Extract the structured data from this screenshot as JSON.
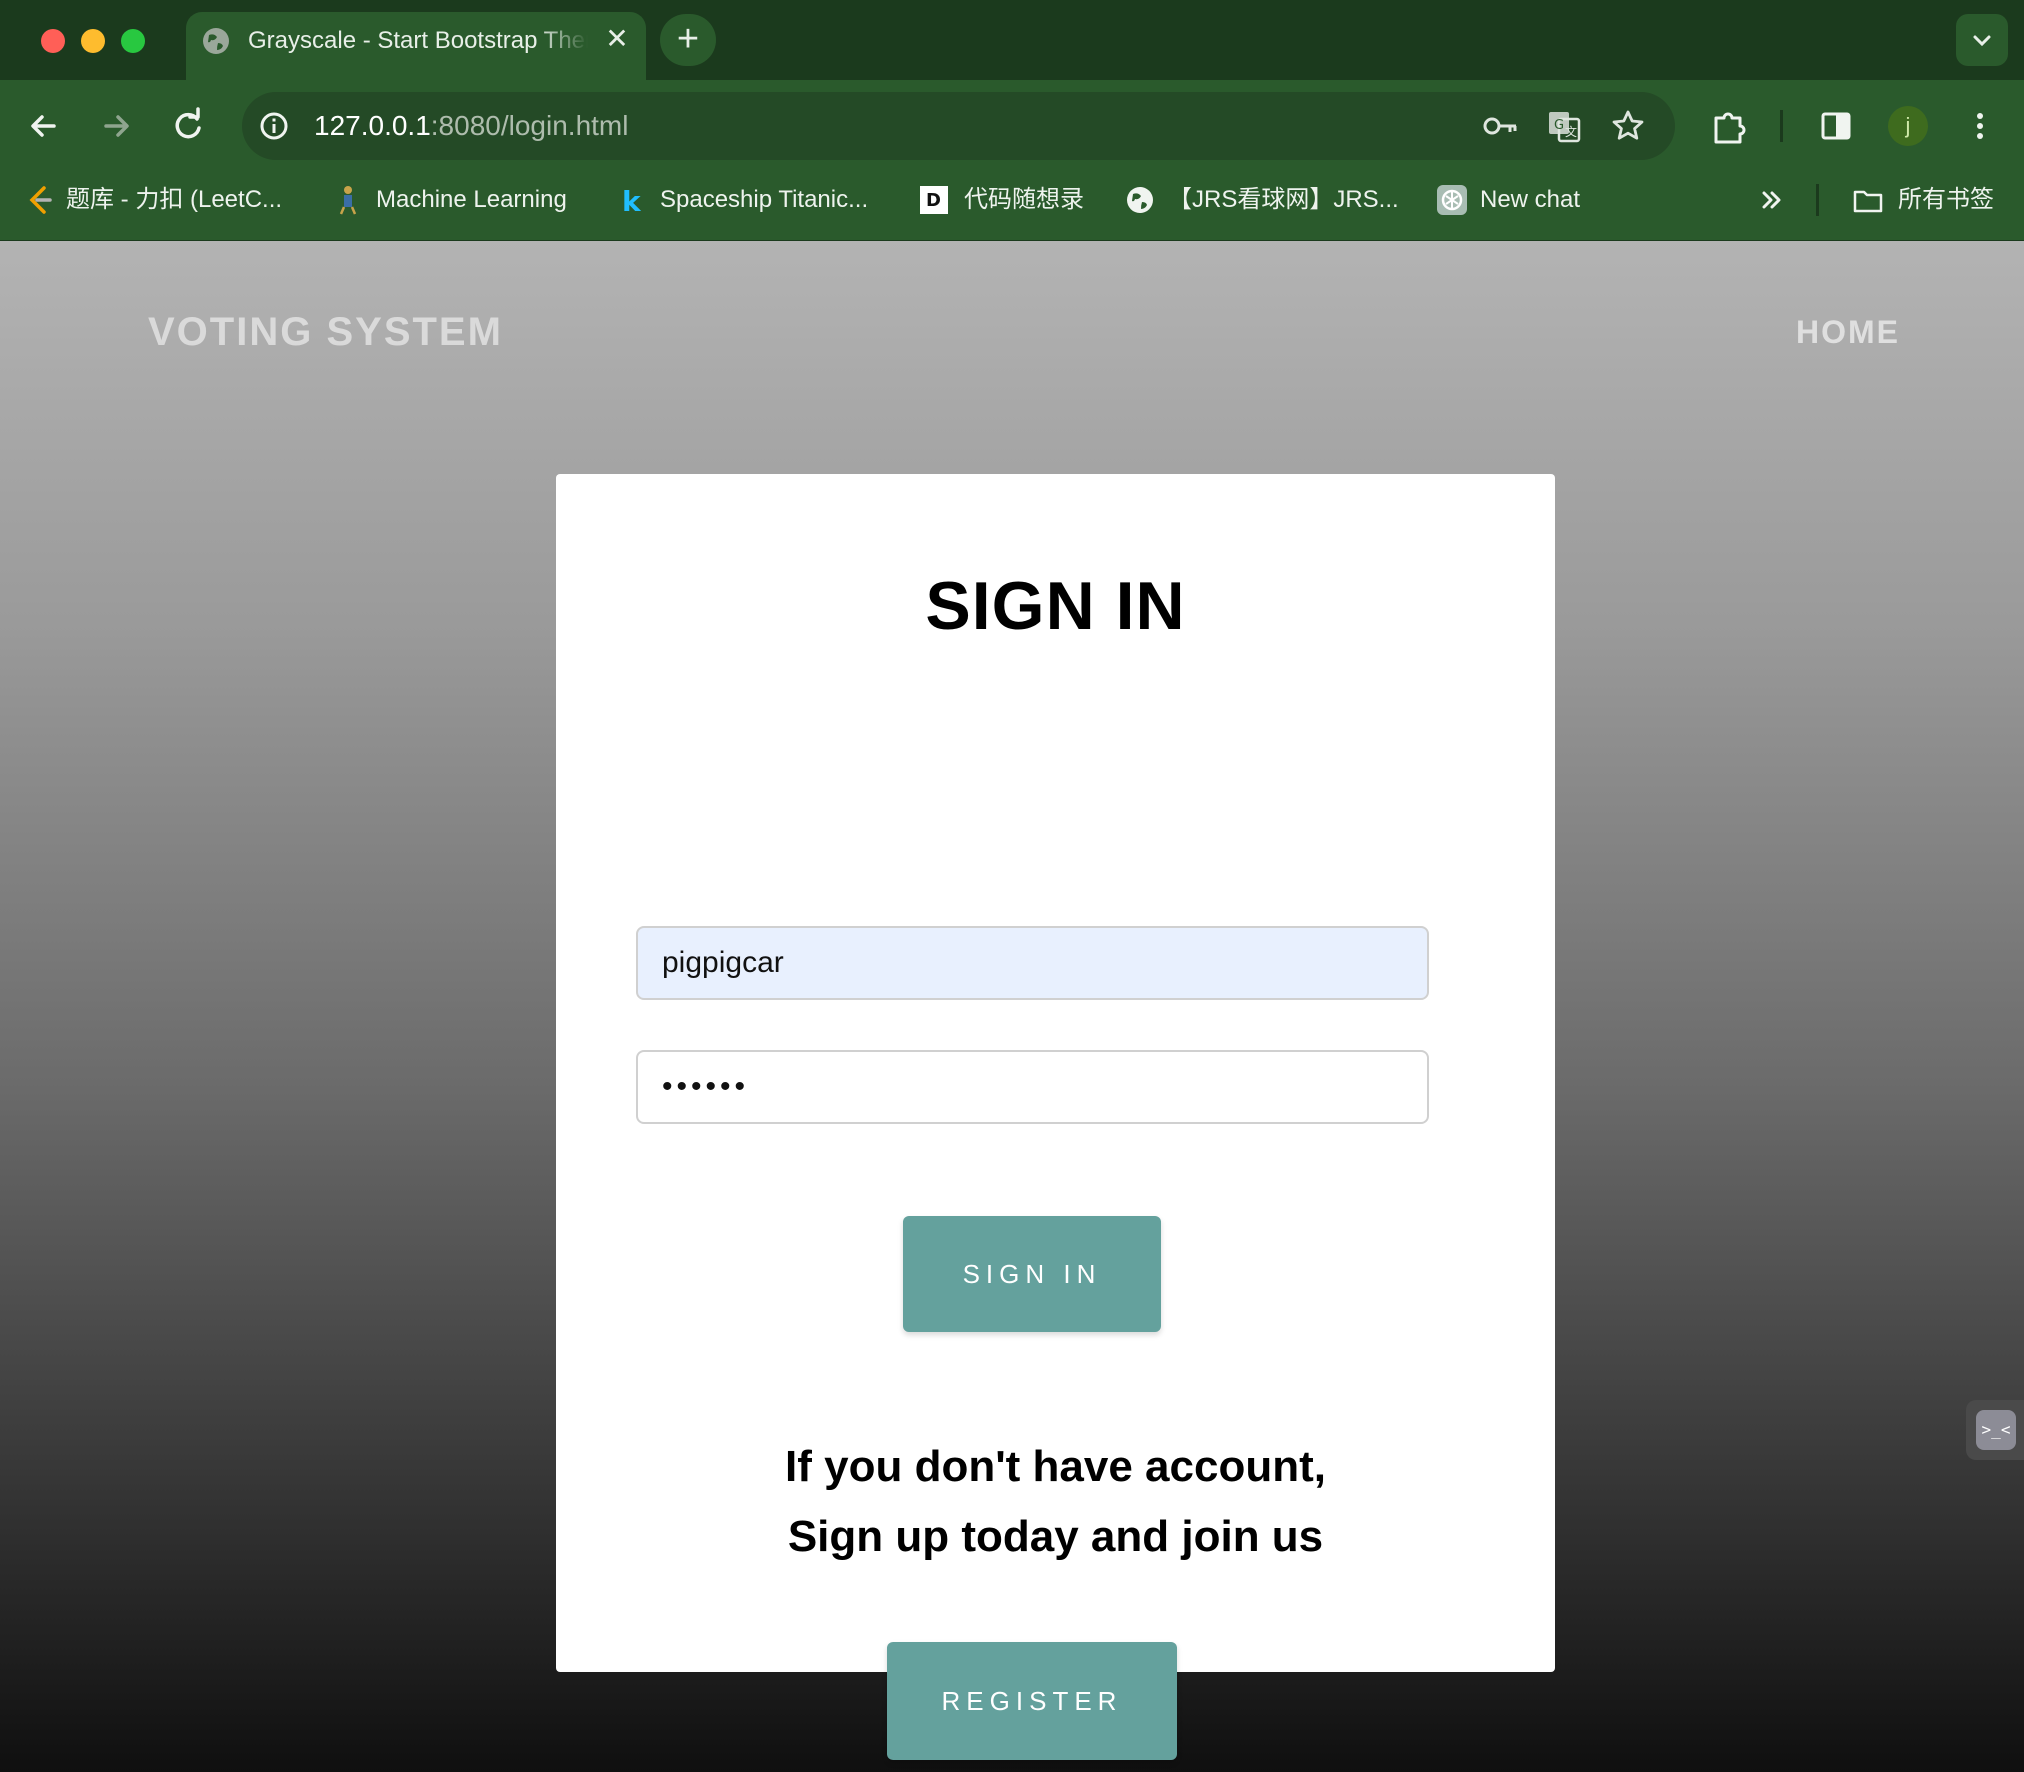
{
  "browser": {
    "tab_title": "Grayscale - Start Bootstrap Theme",
    "url_host": "127.0.0.1",
    "url_rest": ":8080/login.html",
    "profile_initial": "j",
    "bookmarks": [
      {
        "label": "题库 - 力扣 (LeetC...",
        "icon": "leetcode-icon"
      },
      {
        "label": "Machine Learning",
        "icon": "ml-icon"
      },
      {
        "label": "Spaceship Titanic...",
        "icon": "kaggle-icon"
      },
      {
        "label": "代码随想录",
        "icon": "dm-icon"
      },
      {
        "label": "【JRS看球网】JRS...",
        "icon": "globe-icon"
      },
      {
        "label": "New chat",
        "icon": "chatgpt-icon"
      }
    ],
    "all_bookmarks_label": "所有书签"
  },
  "page": {
    "brand": "VOTING SYSTEM",
    "nav_home": "HOME",
    "card": {
      "title": "SIGN IN",
      "username_value": "pigpigcar",
      "password_value": "••••••",
      "signin_button": "SIGN IN",
      "prompt_line1": "If you don't have account,",
      "prompt_line2": "Sign up today and join us",
      "register_button": "REGISTER"
    }
  },
  "colors": {
    "chrome_bg": "#2a5a2c",
    "tabstrip_bg": "#1b3a1d",
    "button_teal": "#64a19d",
    "username_autofill_bg": "#e8f0fe"
  }
}
